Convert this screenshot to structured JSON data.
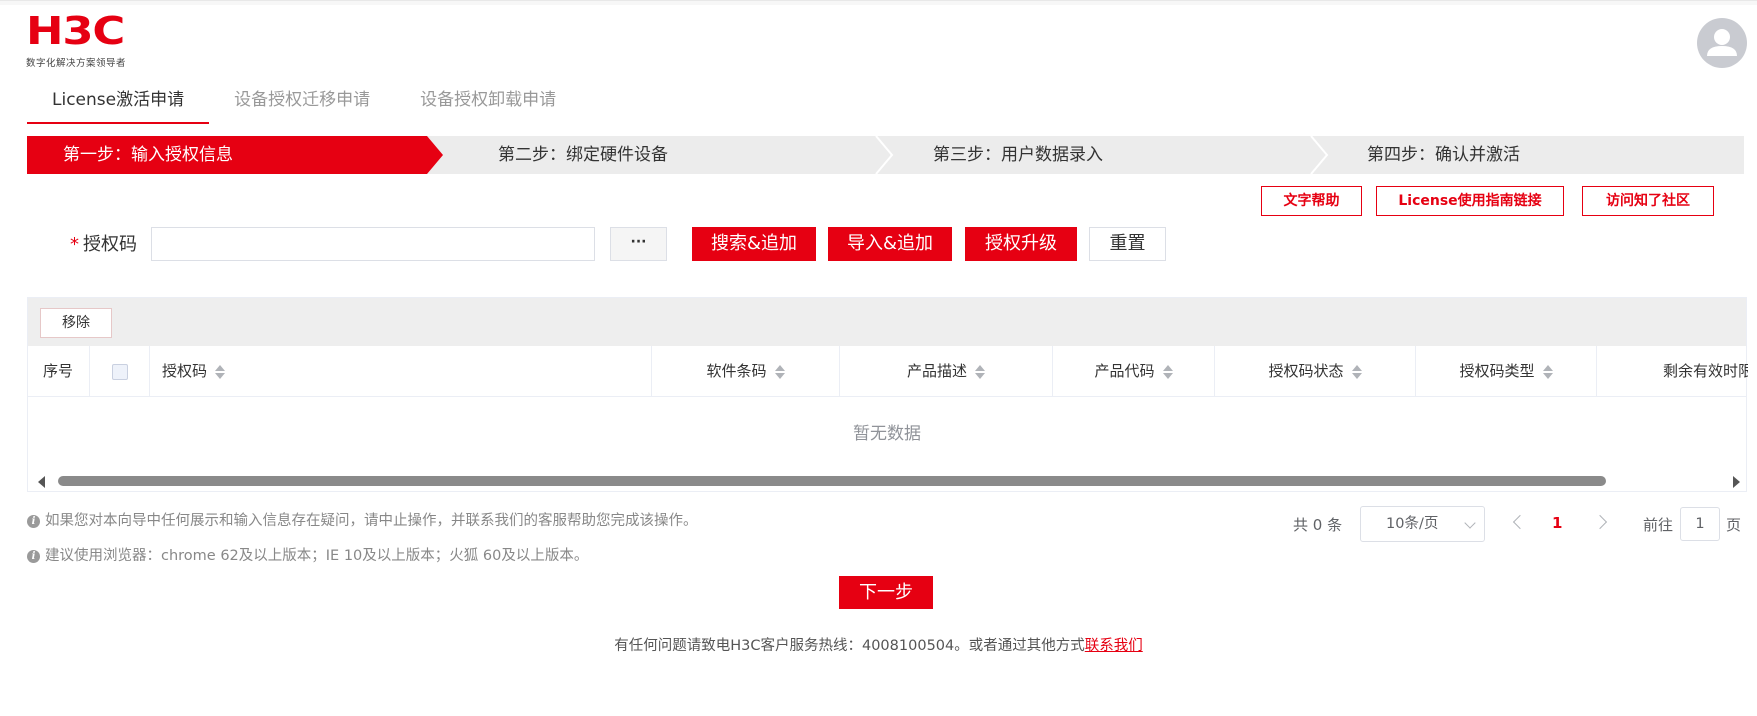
{
  "brand": {
    "logo_text": "H3C",
    "tagline": "数字化解决方案领导者",
    "primary_color": "#e60012"
  },
  "user": {
    "avatar_icon": "user-avatar-icon"
  },
  "tabs": [
    {
      "label": "License激活申请",
      "active": true
    },
    {
      "label": "设备授权迁移申请",
      "active": false
    },
    {
      "label": "设备授权卸载申请",
      "active": false
    }
  ],
  "steps": [
    {
      "label": "第一步：输入授权信息",
      "active": true
    },
    {
      "label": "第二步：绑定硬件设备",
      "active": false
    },
    {
      "label": "第三步：用户数据录入",
      "active": false
    },
    {
      "label": "第四步：确认并激活",
      "active": false
    }
  ],
  "help_links": {
    "text_help": "文字帮助",
    "guide_link": "License使用指南链接",
    "community": "访问知了社区"
  },
  "form": {
    "required_mark": "*",
    "code_label": "授权码",
    "code_value": "",
    "code_placeholder": "",
    "more_button": "···",
    "search_add": "搜索&追加",
    "import_add": "导入&追加",
    "upgrade": "授权升级",
    "reset": "重置"
  },
  "table": {
    "remove_button": "移除",
    "columns": [
      "序号",
      "",
      "授权码",
      "软件条码",
      "产品描述",
      "产品代码",
      "授权码状态",
      "授权码类型",
      "剩余有效时限（天）"
    ],
    "rows": [],
    "empty_text": "暂无数据"
  },
  "notes": [
    "如果您对本向导中任何展示和输入信息存在疑问，请中止操作，并联系我们的客服帮助您完成该操作。",
    "建议使用浏览器：chrome 62及以上版本；IE 10及以上版本；火狐 60及以上版本。"
  ],
  "pagination": {
    "total_text": "共 0 条",
    "page_size": "10条/页",
    "current_page": "1",
    "goto_label": "前往",
    "goto_value": "1",
    "page_unit": "页"
  },
  "next_button": "下一步",
  "footer": {
    "text": "有任何问题请致电H3C客户服务热线：4008100504。或者通过其他方式",
    "link": "联系我们"
  }
}
